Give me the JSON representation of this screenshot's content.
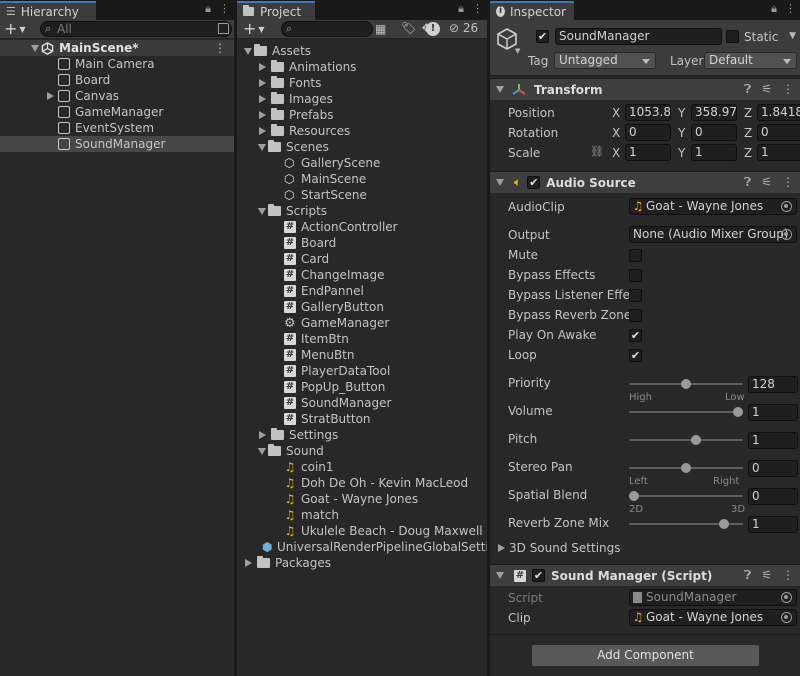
{
  "hierarchy": {
    "tab": "Hierarchy",
    "search_placeholder": "All",
    "scene": "MainScene*",
    "items": [
      {
        "label": "Main Camera",
        "icon": "cube-icon",
        "foldable": false
      },
      {
        "label": "Board",
        "icon": "cube-icon",
        "foldable": false
      },
      {
        "label": "Canvas",
        "icon": "cube-icon",
        "foldable": true
      },
      {
        "label": "GameManager",
        "icon": "cube-icon",
        "foldable": false
      },
      {
        "label": "EventSystem",
        "icon": "cube-icon",
        "foldable": false
      },
      {
        "label": "SoundManager",
        "icon": "cube-icon",
        "foldable": false,
        "selected": true
      }
    ]
  },
  "project": {
    "tab": "Project",
    "hidden_count": "26",
    "tree": [
      {
        "label": "Assets",
        "type": "folder",
        "depth": 0,
        "fold": "open"
      },
      {
        "label": "Animations",
        "type": "folder",
        "depth": 1,
        "fold": "closed"
      },
      {
        "label": "Fonts",
        "type": "folder",
        "depth": 1,
        "fold": "closed"
      },
      {
        "label": "Images",
        "type": "folder",
        "depth": 1,
        "fold": "closed"
      },
      {
        "label": "Prefabs",
        "type": "folder",
        "depth": 1,
        "fold": "closed"
      },
      {
        "label": "Resources",
        "type": "folder",
        "depth": 1,
        "fold": "closed"
      },
      {
        "label": "Scenes",
        "type": "folder",
        "depth": 1,
        "fold": "open"
      },
      {
        "label": "GalleryScene",
        "type": "scene",
        "depth": 2
      },
      {
        "label": "MainScene",
        "type": "scene",
        "depth": 2
      },
      {
        "label": "StartScene",
        "type": "scene",
        "depth": 2
      },
      {
        "label": "Scripts",
        "type": "folder",
        "depth": 1,
        "fold": "open"
      },
      {
        "label": "ActionController",
        "type": "script",
        "depth": 2
      },
      {
        "label": "Board",
        "type": "script",
        "depth": 2
      },
      {
        "label": "Card",
        "type": "script",
        "depth": 2
      },
      {
        "label": "ChangeImage",
        "type": "script",
        "depth": 2
      },
      {
        "label": "EndPannel",
        "type": "script",
        "depth": 2
      },
      {
        "label": "GalleryButton",
        "type": "script",
        "depth": 2
      },
      {
        "label": "GameManager",
        "type": "gear",
        "depth": 2
      },
      {
        "label": "ItemBtn",
        "type": "script",
        "depth": 2
      },
      {
        "label": "MenuBtn",
        "type": "script",
        "depth": 2
      },
      {
        "label": "PlayerDataTool",
        "type": "script",
        "depth": 2
      },
      {
        "label": "PopUp_Button",
        "type": "script",
        "depth": 2
      },
      {
        "label": "SoundManager",
        "type": "script",
        "depth": 2
      },
      {
        "label": "StratButton",
        "type": "script",
        "depth": 2
      },
      {
        "label": "Settings",
        "type": "folder",
        "depth": 1,
        "fold": "closed"
      },
      {
        "label": "Sound",
        "type": "folder",
        "depth": 1,
        "fold": "open"
      },
      {
        "label": "coin1",
        "type": "audio",
        "depth": 2
      },
      {
        "label": "Doh De Oh - Kevin MacLeod",
        "type": "audio",
        "depth": 2
      },
      {
        "label": "Goat - Wayne Jones",
        "type": "audio",
        "depth": 2
      },
      {
        "label": "match",
        "type": "audio",
        "depth": 2
      },
      {
        "label": "Ukulele Beach - Doug Maxwell",
        "type": "audio",
        "depth": 2
      },
      {
        "label": "UniversalRenderPipelineGlobalSetti",
        "type": "asset",
        "depth": 1
      },
      {
        "label": "Packages",
        "type": "folder",
        "depth": 0,
        "fold": "closed"
      }
    ]
  },
  "inspector": {
    "tab": "Inspector",
    "object_name": "SoundManager",
    "static_label": "Static",
    "tag_label": "Tag",
    "tag_value": "Untagged",
    "layer_label": "Layer",
    "layer_value": "Default",
    "transform": {
      "title": "Transform",
      "position_label": "Position",
      "rotation_label": "Rotation",
      "scale_label": "Scale",
      "position": [
        "1053.8",
        "358.97",
        "1.8418"
      ],
      "rotation": [
        "0",
        "0",
        "0"
      ],
      "scale": [
        "1",
        "1",
        "1"
      ],
      "axes": [
        "X",
        "Y",
        "Z"
      ]
    },
    "audio_source": {
      "title": "Audio Source",
      "audioclip_label": "AudioClip",
      "audioclip_value": "Goat - Wayne Jones",
      "output_label": "Output",
      "output_value": "None (Audio Mixer Group)",
      "mute_label": "Mute",
      "bypass_effects_label": "Bypass Effects",
      "bypass_listener_label": "Bypass Listener Effec",
      "bypass_reverb_label": "Bypass Reverb Zones",
      "play_on_awake_label": "Play On Awake",
      "loop_label": "Loop",
      "mute": false,
      "bypass_effects": false,
      "bypass_listener": false,
      "bypass_reverb": false,
      "play_on_awake": true,
      "loop": true,
      "priority_label": "Priority",
      "priority_value": "128",
      "priority_level": 0.5,
      "priority_low": "High",
      "priority_high": "Low",
      "volume_label": "Volume",
      "volume_value": "1",
      "volume_level": 1.0,
      "pitch_label": "Pitch",
      "pitch_value": "1",
      "pitch_level": 0.6,
      "stereo_pan_label": "Stereo Pan",
      "stereo_pan_value": "0",
      "stereo_pan_level": 0.5,
      "stereo_left": "Left",
      "stereo_right": "Right",
      "spatial_blend_label": "Spatial Blend",
      "spatial_blend_value": "0",
      "spatial_blend_level": 0.0,
      "spatial_2d": "2D",
      "spatial_3d": "3D",
      "reverb_mix_label": "Reverb Zone Mix",
      "reverb_mix_value": "1",
      "reverb_mix_level": 0.87,
      "sound_3d_label": "3D Sound Settings"
    },
    "sound_manager": {
      "title": "Sound Manager (Script)",
      "script_label": "Script",
      "script_value": "SoundManager",
      "clip_label": "Clip",
      "clip_value": "Goat - Wayne Jones"
    },
    "add_component": "Add Component"
  },
  "colors": {
    "selection": "#2c5d87",
    "accent": "#3a79bb",
    "audio_icon": "#f2b31a"
  }
}
